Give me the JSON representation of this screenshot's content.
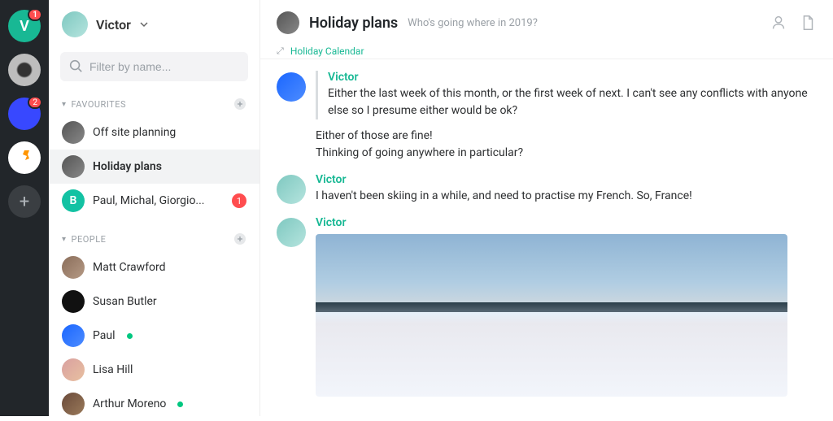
{
  "rail": {
    "workspaces": [
      {
        "letter": "V",
        "badge": "1",
        "active": true
      },
      {
        "letter": "",
        "badge": null,
        "active": false
      },
      {
        "letter": "",
        "badge": "2",
        "active": false
      },
      {
        "letter": "",
        "badge": null,
        "active": false
      }
    ]
  },
  "sidebar": {
    "user": "Victor",
    "filter_placeholder": "Filter by name...",
    "sections": {
      "favourites": {
        "title": "FAVOURITES",
        "items": [
          {
            "label": "Off site planning",
            "active": false,
            "badge": null,
            "letter": null
          },
          {
            "label": "Holiday plans",
            "active": true,
            "badge": null,
            "letter": null
          },
          {
            "label": "Paul, Michal, Giorgio...",
            "active": false,
            "badge": "1",
            "letter": "B"
          }
        ]
      },
      "people": {
        "title": "PEOPLE",
        "items": [
          {
            "label": "Matt Crawford",
            "online": false
          },
          {
            "label": "Susan Butler",
            "online": false
          },
          {
            "label": "Paul",
            "online": true
          },
          {
            "label": "Lisa Hill",
            "online": false
          },
          {
            "label": "Arthur Moreno",
            "online": true
          }
        ]
      }
    }
  },
  "header": {
    "title": "Holiday plans",
    "subtitle": "Who's going where in 2019?"
  },
  "calendar_tag": "Holiday Calendar",
  "messages": [
    {
      "author": "Victor",
      "quoted": {
        "author": "Victor",
        "text": "Either the last week of this month, or the first week of next. I can't see any conflicts with anyone else so I presume either would be ok?"
      },
      "lines": [
        "Either of those are fine!",
        "Thinking of going anywhere in particular?"
      ]
    },
    {
      "author": "Victor",
      "lines": [
        "I haven't been skiing in a while, and need to practise my French. So, France!"
      ]
    },
    {
      "author": "Victor",
      "image": true
    }
  ]
}
